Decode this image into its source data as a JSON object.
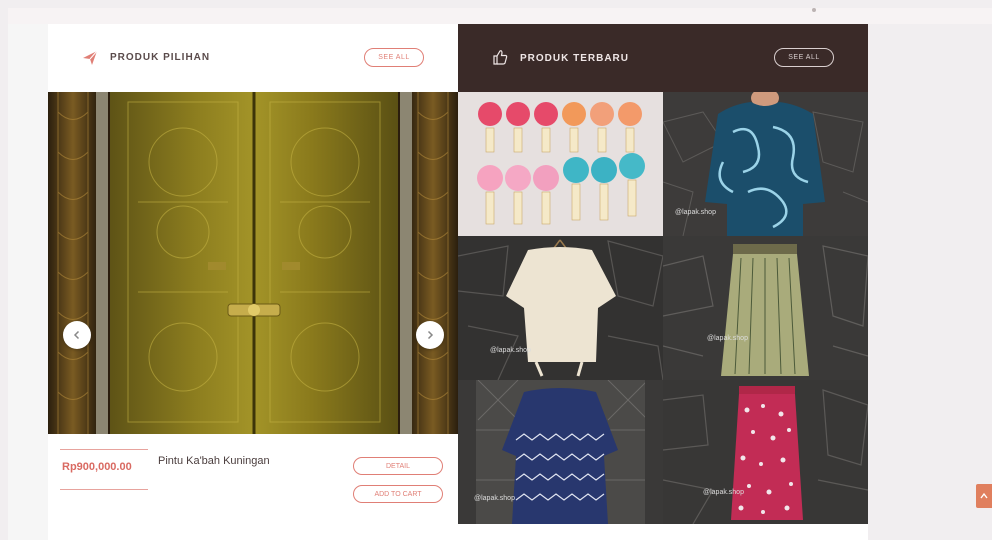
{
  "featured": {
    "title": "PRODUK PILIHAN",
    "see_all_label": "SEE ALL",
    "icon": "paper-plane-icon",
    "product": {
      "price": "Rp900,000.00",
      "name": "Pintu Ka'bah Kuningan",
      "detail_label": "DETAIL",
      "cart_label": "ADD TO CART"
    }
  },
  "latest": {
    "title": "PRODUK TERBARU",
    "see_all_label": "SEE ALL",
    "icon": "thumbs-up-icon",
    "tiles": [
      {
        "name": "pompom-earrings"
      },
      {
        "name": "batik-top"
      },
      {
        "name": "cream-blouse"
      },
      {
        "name": "green-skirt"
      },
      {
        "name": "zigzag-dress"
      },
      {
        "name": "floral-skirt"
      }
    ],
    "watermark": "@lapak.shop"
  },
  "colors": {
    "accent": "#e07f76",
    "dark_header": "#3a2a28",
    "float_button": "#e07f5e"
  }
}
